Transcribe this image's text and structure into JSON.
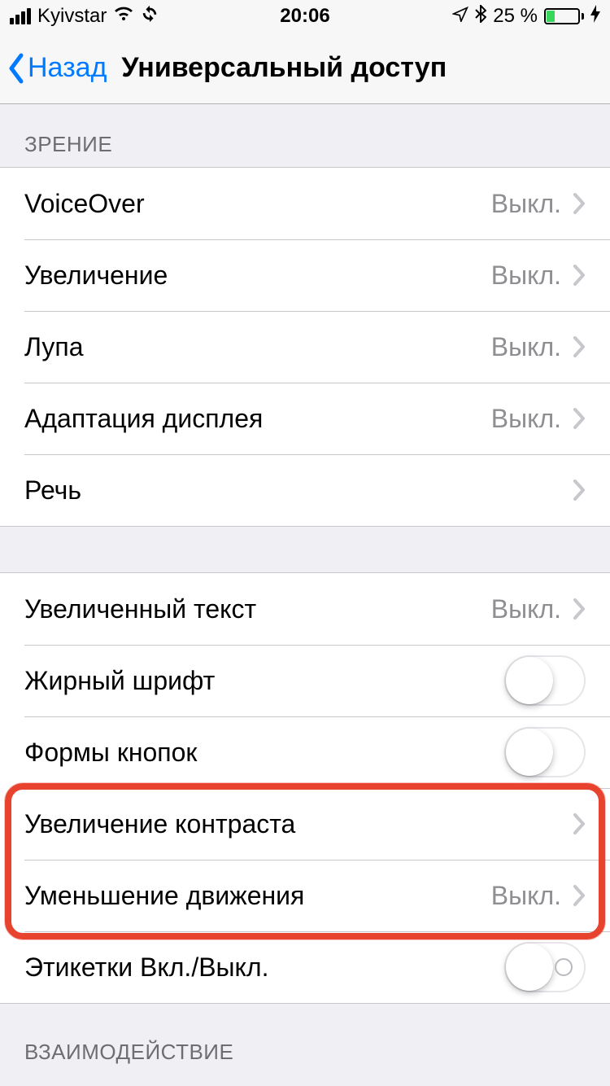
{
  "status": {
    "carrier": "Kyivstar",
    "time": "20:06",
    "battery_pct": "25 %"
  },
  "nav": {
    "back": "Назад",
    "title": "Универсальный доступ"
  },
  "sections": {
    "vision_header": "ЗРЕНИЕ",
    "interaction_header": "ВЗАИМОДЕЙСТВИЕ"
  },
  "rows": {
    "voiceover": {
      "label": "VoiceOver",
      "value": "Выкл."
    },
    "zoom": {
      "label": "Увеличение",
      "value": "Выкл."
    },
    "magnifier": {
      "label": "Лупа",
      "value": "Выкл."
    },
    "display": {
      "label": "Адаптация дисплея",
      "value": "Выкл."
    },
    "speech": {
      "label": "Речь"
    },
    "larger_text": {
      "label": "Увеличенный текст",
      "value": "Выкл."
    },
    "bold_text": {
      "label": "Жирный шрифт"
    },
    "button_shapes": {
      "label": "Формы кнопок"
    },
    "increase_contrast": {
      "label": "Увеличение контраста"
    },
    "reduce_motion": {
      "label": "Уменьшение движения",
      "value": "Выкл."
    },
    "on_off_labels": {
      "label": "Этикетки Вкл./Выкл."
    }
  },
  "annotation_highlight": "rows 'Увеличение контраста' and 'Уменьшение движения' are circled in red"
}
